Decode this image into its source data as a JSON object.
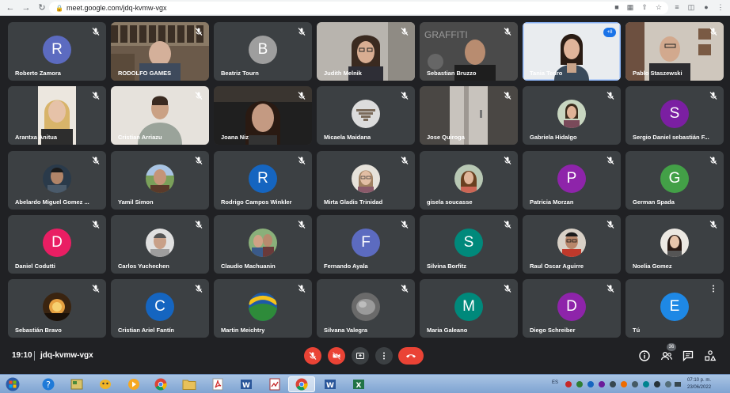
{
  "browser": {
    "url": "meet.google.com/jdq-kvmw-vgx"
  },
  "tiles": [
    {
      "name": "Roberto Zamora",
      "kind": "letter",
      "letter": "R",
      "color": "#5c6bc0"
    },
    {
      "name": "RODOLFO GAMES",
      "kind": "video",
      "scene": "library"
    },
    {
      "name": "Beatriz Tourn",
      "kind": "letter",
      "letter": "B",
      "color": "#9e9e9e"
    },
    {
      "name": "Judith Melnik",
      "kind": "video",
      "scene": "woman-glasses"
    },
    {
      "name": "Sebastian Bruzzo",
      "kind": "video",
      "scene": "man-graffiti"
    },
    {
      "name": "Tania Tedro",
      "kind": "video",
      "scene": "woman-bright",
      "badge": "+8"
    },
    {
      "name": "Pablo Staszewski",
      "kind": "video",
      "scene": "man-room"
    },
    {
      "name": "Arantxa Anitua",
      "kind": "video",
      "scene": "woman-blonde"
    },
    {
      "name": "Cristian Arriazu",
      "kind": "video",
      "scene": "man-hoodie"
    },
    {
      "name": "Joana Niz",
      "kind": "video",
      "scene": "woman-dark"
    },
    {
      "name": "Micaela Maidana",
      "kind": "photo",
      "photo": "stairs"
    },
    {
      "name": "Jose Quiroga",
      "kind": "video",
      "scene": "door"
    },
    {
      "name": "Gabriela Hidalgo",
      "kind": "photo",
      "photo": "woman"
    },
    {
      "name": "Sergio Daniel sebastián F...",
      "kind": "letter",
      "letter": "S",
      "color": "#7b1fa2"
    },
    {
      "name": "Abelardo Miguel Gomez ...",
      "kind": "photo",
      "photo": "man-dark"
    },
    {
      "name": "Yamil Simon",
      "kind": "photo",
      "photo": "man-outdoor"
    },
    {
      "name": "Rodrigo Campos Winkler",
      "kind": "letter",
      "letter": "R",
      "color": "#1565c0"
    },
    {
      "name": "Mirta Gladis Trinidad",
      "kind": "photo",
      "photo": "woman-light"
    },
    {
      "name": "gisela soucasse",
      "kind": "photo",
      "photo": "woman-hair"
    },
    {
      "name": "Patricia Morzan",
      "kind": "letter",
      "letter": "P",
      "color": "#8e24aa"
    },
    {
      "name": "German Spada",
      "kind": "letter",
      "letter": "G",
      "color": "#43a047"
    },
    {
      "name": "Daniel Codutti",
      "kind": "letter",
      "letter": "D",
      "color": "#e91e63"
    },
    {
      "name": "Carlos Yuchechen",
      "kind": "photo",
      "photo": "man-gray"
    },
    {
      "name": "Claudio Machuanin",
      "kind": "photo",
      "photo": "two-people"
    },
    {
      "name": "Fernando Ayala",
      "kind": "letter",
      "letter": "F",
      "color": "#5c6bc0"
    },
    {
      "name": "Silvina Borfitz",
      "kind": "letter",
      "letter": "S",
      "color": "#00897b"
    },
    {
      "name": "Raul Oscar Aguirre",
      "kind": "photo",
      "photo": "man-glasses"
    },
    {
      "name": "Noelia Gomez",
      "kind": "photo",
      "photo": "woman-pale"
    },
    {
      "name": "Sebastián Bravo",
      "kind": "photo",
      "photo": "sunset"
    },
    {
      "name": "Cristian Ariel Fantín",
      "kind": "letter",
      "letter": "C",
      "color": "#1565c0"
    },
    {
      "name": "Martin Meichtry",
      "kind": "photo",
      "photo": "logo"
    },
    {
      "name": "Silvana Valegra",
      "kind": "photo",
      "photo": "gray-blob"
    },
    {
      "name": "Maria Galeano",
      "kind": "letter",
      "letter": "M",
      "color": "#00897b"
    },
    {
      "name": "Diego Schreiber",
      "kind": "letter",
      "letter": "D",
      "color": "#8e24aa"
    },
    {
      "name": "Tú",
      "kind": "letter",
      "letter": "E",
      "color": "#1e88e5",
      "self": true
    }
  ],
  "controls": {
    "time": "19:10",
    "meeting_code": "jdq-kvmw-vgx",
    "people_count": "36"
  },
  "taskbar": {
    "lang": "ES",
    "time": "07:10 p. m.",
    "date": "23/06/2022"
  }
}
